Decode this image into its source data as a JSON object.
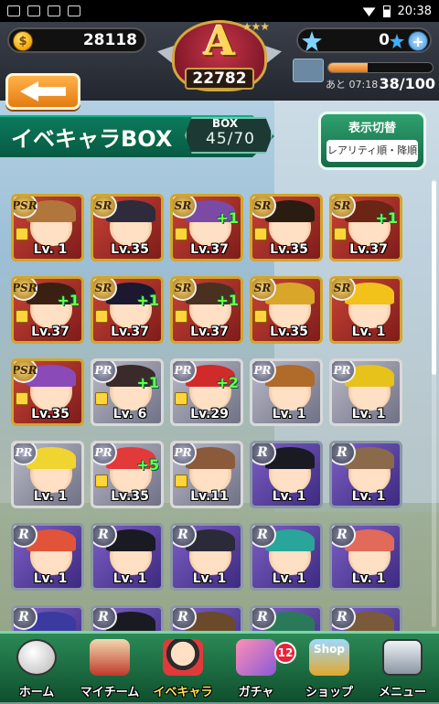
{
  "statusbar": {
    "time": "20:38"
  },
  "hud": {
    "coins": "28118",
    "rank_letter": "A",
    "rank_score": "22782",
    "gems": "0",
    "stamina_timer": "あと 07:18",
    "stamina_count": "38/100",
    "stamina_fraction": 0.38
  },
  "header": {
    "title": "イベキャラBOX",
    "box_label": "BOX",
    "box_count": "45/70",
    "toggle_title": "表示切替",
    "toggle_sort": "レアリティ順・降順"
  },
  "cards": [
    {
      "rarity": "PSR",
      "lv": "Lv. 1",
      "lock": true,
      "plus": "",
      "hair": "#b1763b",
      "frame": "sr"
    },
    {
      "rarity": "SR",
      "lv": "Lv.35",
      "lock": false,
      "plus": "",
      "hair": "#2d2b3c",
      "frame": "sr"
    },
    {
      "rarity": "SR",
      "lv": "Lv.37",
      "lock": true,
      "plus": "+1",
      "hair": "#7a4aa5",
      "frame": "sr"
    },
    {
      "rarity": "SR",
      "lv": "Lv.35",
      "lock": true,
      "plus": "",
      "hair": "#2b1c12",
      "frame": "sr"
    },
    {
      "rarity": "SR",
      "lv": "Lv.37",
      "lock": true,
      "plus": "+1",
      "hair": "#6c2414",
      "frame": "sr"
    },
    {
      "rarity": "PSR",
      "lv": "Lv.37",
      "lock": true,
      "plus": "+1",
      "hair": "#3a2012",
      "frame": "sr"
    },
    {
      "rarity": "SR",
      "lv": "Lv.37",
      "lock": true,
      "plus": "+1",
      "hair": "#1c1830",
      "frame": "sr"
    },
    {
      "rarity": "SR",
      "lv": "Lv.37",
      "lock": true,
      "plus": "+1",
      "hair": "#4a3020",
      "frame": "sr"
    },
    {
      "rarity": "SR",
      "lv": "Lv.35",
      "lock": true,
      "plus": "",
      "hair": "#d9a62a",
      "frame": "sr"
    },
    {
      "rarity": "SR",
      "lv": "Lv. 1",
      "lock": false,
      "plus": "",
      "hair": "#f2c21a",
      "frame": "sr"
    },
    {
      "rarity": "PSR",
      "lv": "Lv.35",
      "lock": true,
      "plus": "",
      "hair": "#8a4ab8",
      "frame": "sr"
    },
    {
      "rarity": "PR",
      "lv": "Lv. 6",
      "lock": true,
      "plus": "+1",
      "hair": "#3a2a2a",
      "frame": "pr"
    },
    {
      "rarity": "PR",
      "lv": "Lv.29",
      "lock": true,
      "plus": "+2",
      "hair": "#d02a2a",
      "frame": "pr"
    },
    {
      "rarity": "PR",
      "lv": "Lv. 1",
      "lock": false,
      "plus": "",
      "hair": "#b06a2a",
      "frame": "pr"
    },
    {
      "rarity": "PR",
      "lv": "Lv. 1",
      "lock": false,
      "plus": "",
      "hair": "#e6c21a",
      "frame": "pr"
    },
    {
      "rarity": "PR",
      "lv": "Lv. 1",
      "lock": false,
      "plus": "",
      "hair": "#f0d430",
      "frame": "pr"
    },
    {
      "rarity": "PR",
      "lv": "Lv.35",
      "lock": true,
      "plus": "+5",
      "hair": "#e23a3a",
      "frame": "pr"
    },
    {
      "rarity": "PR",
      "lv": "Lv.11",
      "lock": true,
      "plus": "",
      "hair": "#8a5a3a",
      "frame": "pr"
    },
    {
      "rarity": "R",
      "lv": "Lv. 1",
      "lock": false,
      "plus": "",
      "hair": "#1a1a22",
      "frame": "r"
    },
    {
      "rarity": "R",
      "lv": "Lv. 1",
      "lock": false,
      "plus": "",
      "hair": "#8a6a4a",
      "frame": "r"
    },
    {
      "rarity": "R",
      "lv": "Lv. 1",
      "lock": false,
      "plus": "",
      "hair": "#e2543a",
      "frame": "r"
    },
    {
      "rarity": "R",
      "lv": "Lv. 1",
      "lock": false,
      "plus": "",
      "hair": "#1a1a22",
      "frame": "r"
    },
    {
      "rarity": "R",
      "lv": "Lv. 1",
      "lock": false,
      "plus": "",
      "hair": "#2a2a38",
      "frame": "r"
    },
    {
      "rarity": "R",
      "lv": "Lv. 1",
      "lock": false,
      "plus": "",
      "hair": "#2aa59a",
      "frame": "r"
    },
    {
      "rarity": "R",
      "lv": "Lv. 1",
      "lock": false,
      "plus": "",
      "hair": "#e26a5a",
      "frame": "r"
    },
    {
      "rarity": "R",
      "lv": "",
      "lock": false,
      "plus": "",
      "hair": "#3a3aa0",
      "frame": "r"
    },
    {
      "rarity": "R",
      "lv": "",
      "lock": false,
      "plus": "",
      "hair": "#1a1a22",
      "frame": "r"
    },
    {
      "rarity": "R",
      "lv": "",
      "lock": false,
      "plus": "",
      "hair": "#6a4a2a",
      "frame": "r"
    },
    {
      "rarity": "R",
      "lv": "",
      "lock": false,
      "plus": "",
      "hair": "#2a7a5a",
      "frame": "r"
    },
    {
      "rarity": "R",
      "lv": "",
      "lock": false,
      "plus": "",
      "hair": "#7a5a3a",
      "frame": "r"
    }
  ],
  "nav": {
    "home": "ホーム",
    "myteam": "マイチーム",
    "eventchara": "イベキャラ",
    "gacha": "ガチャ",
    "gacha_badge": "12",
    "shop": "ショップ",
    "shop_sign": "Shop",
    "menu": "メニュー"
  },
  "colors": {
    "accent_green": "#0c7a5c",
    "back_orange": "#e37c12",
    "active_nav": "#ffe25a"
  }
}
